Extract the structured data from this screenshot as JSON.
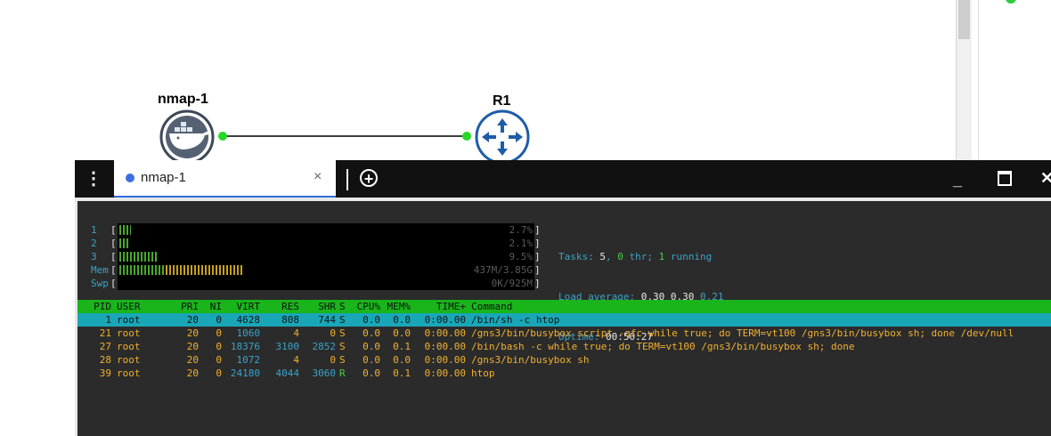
{
  "topology": {
    "nodes": [
      {
        "label": "nmap-1",
        "icon": "docker-whale-icon"
      },
      {
        "label": "R1",
        "icon": "router-icon"
      }
    ],
    "link_status_color": "#27d827"
  },
  "console": {
    "menu_icon": "⋮",
    "tab": {
      "label": "nmap-1",
      "close": "×"
    },
    "add_tab_icon": "+",
    "window": {
      "minimize": "_",
      "close": "✕"
    }
  },
  "htop": {
    "meters": [
      {
        "label": "1",
        "value_text": "2.7%",
        "level": 0.027
      },
      {
        "label": "2",
        "value_text": "2.1%",
        "level": 0.021
      },
      {
        "label": "3",
        "value_text": "9.5%",
        "level": 0.095
      },
      {
        "label": "Mem",
        "value_text": "437M/3.85G",
        "level": 0.3
      },
      {
        "label": "Swp",
        "value_text": "0K/925M",
        "level": 0
      }
    ],
    "tasks": {
      "label": "Tasks: ",
      "count": "5",
      "sep": ", ",
      "thr": "0",
      "thr_label": " thr; ",
      "running": "1",
      "running_label": " running"
    },
    "load": {
      "label": "Load average: ",
      "v1": "0.30",
      "v2": "0.30",
      "v3": "0.21"
    },
    "uptime": {
      "label": "Uptime: ",
      "value": "00:50:27"
    },
    "columns": [
      "PID",
      "USER",
      "PRI",
      "NI",
      "VIRT",
      "RES",
      "SHR",
      "S",
      "CPU%",
      "MEM%",
      "TIME+",
      "Command"
    ],
    "processes": [
      {
        "pid": "1",
        "user": "root",
        "pri": "20",
        "ni": "0",
        "virt": "4628",
        "res": "808",
        "shr": "744",
        "s": "S",
        "cpu": "0.0",
        "mem": "0.0",
        "time": "0:00.00",
        "cmd": "/bin/sh -c htop",
        "selected": true
      },
      {
        "pid": "21",
        "user": "root",
        "pri": "20",
        "ni": "0",
        "virt": "1060",
        "res": "4",
        "shr": "0",
        "s": "S",
        "cpu": "0.0",
        "mem": "0.0",
        "time": "0:00.00",
        "cmd": "/gns3/bin/busybox script -qfc while true; do TERM=vt100 /gns3/bin/busybox sh; done /dev/null"
      },
      {
        "pid": "27",
        "user": "root",
        "pri": "20",
        "ni": "0",
        "virt": "18376",
        "res": "3100",
        "shr": "2852",
        "s": "S",
        "cpu": "0.0",
        "mem": "0.1",
        "time": "0:00.00",
        "cmd": "/bin/bash -c while true; do TERM=vt100 /gns3/bin/busybox sh; done"
      },
      {
        "pid": "28",
        "user": "root",
        "pri": "20",
        "ni": "0",
        "virt": "1072",
        "res": "4",
        "shr": "0",
        "s": "S",
        "cpu": "0.0",
        "mem": "0.0",
        "time": "0:00.00",
        "cmd": "/gns3/bin/busybox sh"
      },
      {
        "pid": "39",
        "user": "root",
        "pri": "20",
        "ni": "0",
        "virt": "24180",
        "res": "4044",
        "shr": "3060",
        "s": "R",
        "cpu": "0.0",
        "mem": "0.1",
        "time": "0:00.00",
        "cmd": "htop"
      }
    ]
  }
}
